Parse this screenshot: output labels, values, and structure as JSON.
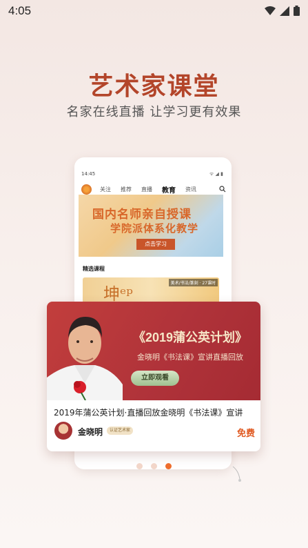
{
  "status_bar": {
    "time": "4:05"
  },
  "hero": {
    "title": "艺术家课堂",
    "subtitle": "名家在线直播 让学习更有效果"
  },
  "phone": {
    "time": "14:45",
    "status_right": "ᯤ ◢ ▮",
    "tabs": [
      "关注",
      "推荐",
      "直播",
      "教育",
      "资讯"
    ],
    "active_tab": "教育",
    "banner": {
      "line1": "国内名师亲自授课",
      "line2": "学院派体系化教学",
      "button": "点击学习"
    },
    "section_title": "精选课程",
    "course_tag": "美术/书法/篆刻 · 27课时",
    "course_art": "坤ᵉᵖ"
  },
  "card": {
    "title": "《2019蒲公英计划》",
    "subtitle": "金晓明《书法课》宣讲直播回放",
    "watch_button": "立即观看",
    "description": "2019年蒲公英计划·直播回放金晓明《书法课》宣讲",
    "author": "金晓明",
    "badge": "认证艺术家",
    "price": "免费"
  },
  "pagination": {
    "count": 3,
    "active_index": 2
  },
  "colors": {
    "accent": "#b3452a",
    "price": "#e05a22",
    "banner": "#b0333a"
  }
}
